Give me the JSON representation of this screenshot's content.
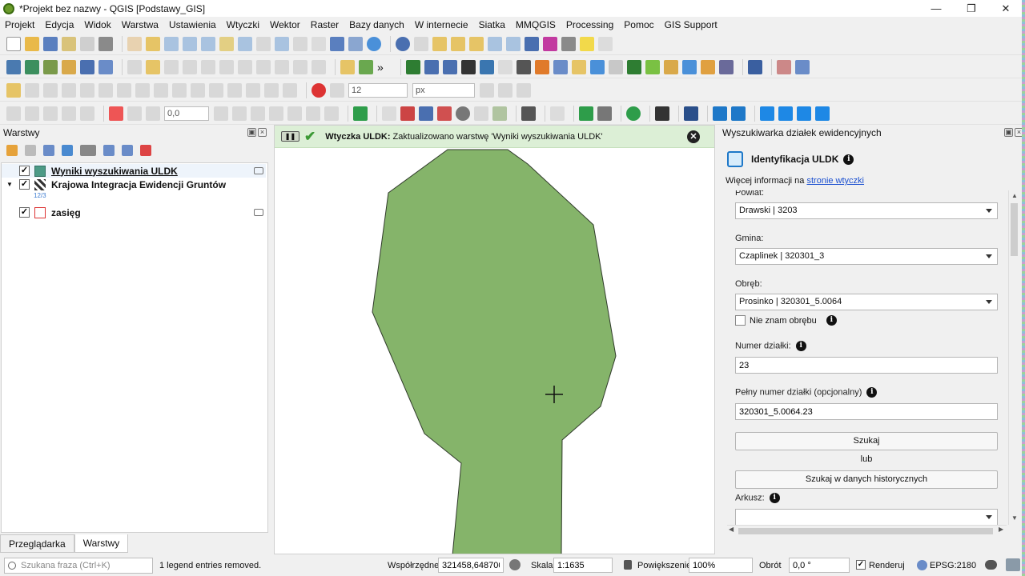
{
  "window": {
    "title": "*Projekt bez nazwy - QGIS [Podstawy_GIS]"
  },
  "menu": [
    "Projekt",
    "Edycja",
    "Widok",
    "Warstwa",
    "Ustawienia",
    "Wtyczki",
    "Wektor",
    "Raster",
    "Bazy danych",
    "W internecie",
    "Siatka",
    "MMQGIS",
    "Processing",
    "Pomoc",
    "GIS Support"
  ],
  "toolbar": {
    "font_size": "12",
    "font_unit": "px",
    "value": "0,0"
  },
  "layers_panel": {
    "title": "Warstwy",
    "layers": [
      {
        "name": "Wyniki wyszukiwania ULDK",
        "checked": "✓"
      },
      {
        "name": "Krajowa Integracja Ewidencji Gruntów",
        "sub": "12/3",
        "checked": "✓"
      },
      {
        "name": "zasięg",
        "checked": "✓"
      }
    ],
    "tabs": [
      "Przeglądarka",
      "Warstwy"
    ]
  },
  "map": {
    "message_plugin": "Wtyczka ULDK:",
    "message_text": "Zaktualizowano warstwę 'Wyniki wyszukiwania ULDK'",
    "parcel_color": "#85b46a"
  },
  "uldk": {
    "panel_title": "Wyszukiwarka działek ewidencyjnych",
    "heading": "Identyfikacja ULDK",
    "info_text": "Więcej informacji na",
    "info_link": "stronie wtyczki",
    "powiat_label": "Powiat:",
    "powiat_value": "Drawski | 3203",
    "gmina_label": "Gmina:",
    "gmina_value": "Czaplinek | 320301_3",
    "obreb_label": "Obręb:",
    "obreb_value": "Prosinko | 320301_5.0064",
    "unknown_obreb": "Nie znam obrębu",
    "numer_label": "Numer działki:",
    "numer_value": "23",
    "full_label": "Pełny numer działki (opcjonalny)",
    "full_value": "320301_5.0064.23",
    "search_button": "Szukaj",
    "or_text": "lub",
    "history_button": "Szukaj w danych historycznych",
    "arkusz_label": "Arkusz:"
  },
  "status": {
    "search_placeholder": "Szukana fraza (Ctrl+K)",
    "message": "1 legend entries removed.",
    "coord_label": "Współrzędne",
    "coord_value": "321458,648700",
    "scale_label": "Skala",
    "scale_value": "1:1635",
    "zoom_label": "Powiększenie",
    "zoom_value": "100%",
    "rotation_label": "Obrót",
    "rotation_value": "0,0 °",
    "render_label": "Renderuj",
    "crs": "EPSG:2180"
  }
}
